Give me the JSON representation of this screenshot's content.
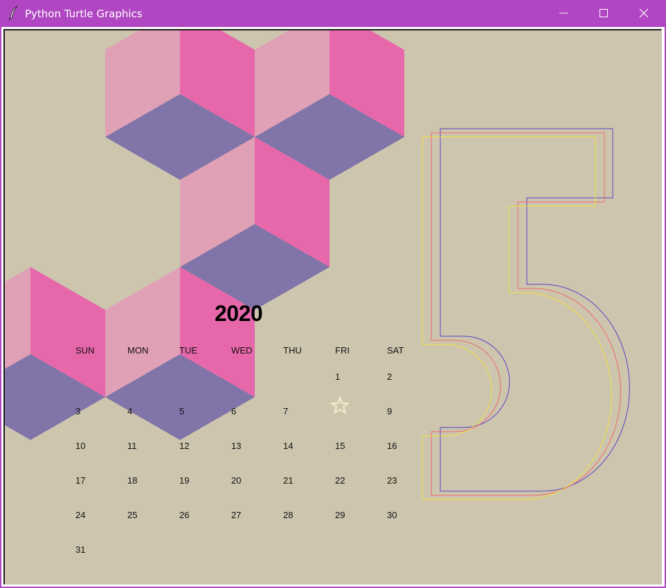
{
  "window": {
    "title": "Python Turtle Graphics",
    "titlebar_color": "#b146c2",
    "icons": [
      "feather-icon",
      "minimize-icon",
      "maximize-icon",
      "close-icon"
    ]
  },
  "canvas": {
    "background": "#cdc5ae",
    "cube_colors": {
      "left_face": "#e0a0b6",
      "right_face": "#e668aa",
      "top_face": "#8074a8"
    },
    "outline_colors": [
      "#5a3fc8",
      "#f06a6a",
      "#f2e23a"
    ]
  },
  "calendar": {
    "year": "2020",
    "big_month_numeral": "5",
    "weekdays": [
      "SUN",
      "MON",
      "TUE",
      "WED",
      "THU",
      "FRI",
      "SAT"
    ],
    "weeks": [
      [
        "",
        "",
        "",
        "",
        "",
        "1",
        "2"
      ],
      [
        "3",
        "4",
        "5",
        "6",
        "7",
        "",
        "9"
      ],
      [
        "10",
        "11",
        "12",
        "13",
        "14",
        "15",
        "16"
      ],
      [
        "17",
        "18",
        "19",
        "20",
        "21",
        "22",
        "23"
      ],
      [
        "24",
        "25",
        "26",
        "27",
        "28",
        "29",
        "30"
      ],
      [
        "31",
        "",
        "",
        "",
        "",
        "",
        ""
      ]
    ],
    "turtle_cursor": "star-icon"
  }
}
